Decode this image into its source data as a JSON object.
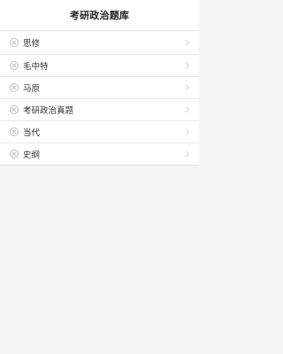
{
  "header": {
    "title": "考研政治题库"
  },
  "list": {
    "items": [
      {
        "label": "思修",
        "icon": "close-circle-icon",
        "trailing": "chevron-right-icon"
      },
      {
        "label": "毛中特",
        "icon": "close-circle-icon",
        "trailing": "chevron-right-icon"
      },
      {
        "label": "马原",
        "icon": "close-circle-icon",
        "trailing": "chevron-right-icon"
      },
      {
        "label": "考研政治真题",
        "icon": "close-circle-icon",
        "trailing": "chevron-right-icon"
      },
      {
        "label": "当代",
        "icon": "close-circle-icon",
        "trailing": "chevron-right-icon"
      },
      {
        "label": "史纲",
        "icon": "close-circle-icon",
        "trailing": "chevron-right-icon"
      }
    ]
  },
  "colors": {
    "background": "#f5f5f5",
    "surface": "#ffffff",
    "divider": "#e8e8e8",
    "text": "#333333",
    "icon": "#bcbcbc"
  }
}
